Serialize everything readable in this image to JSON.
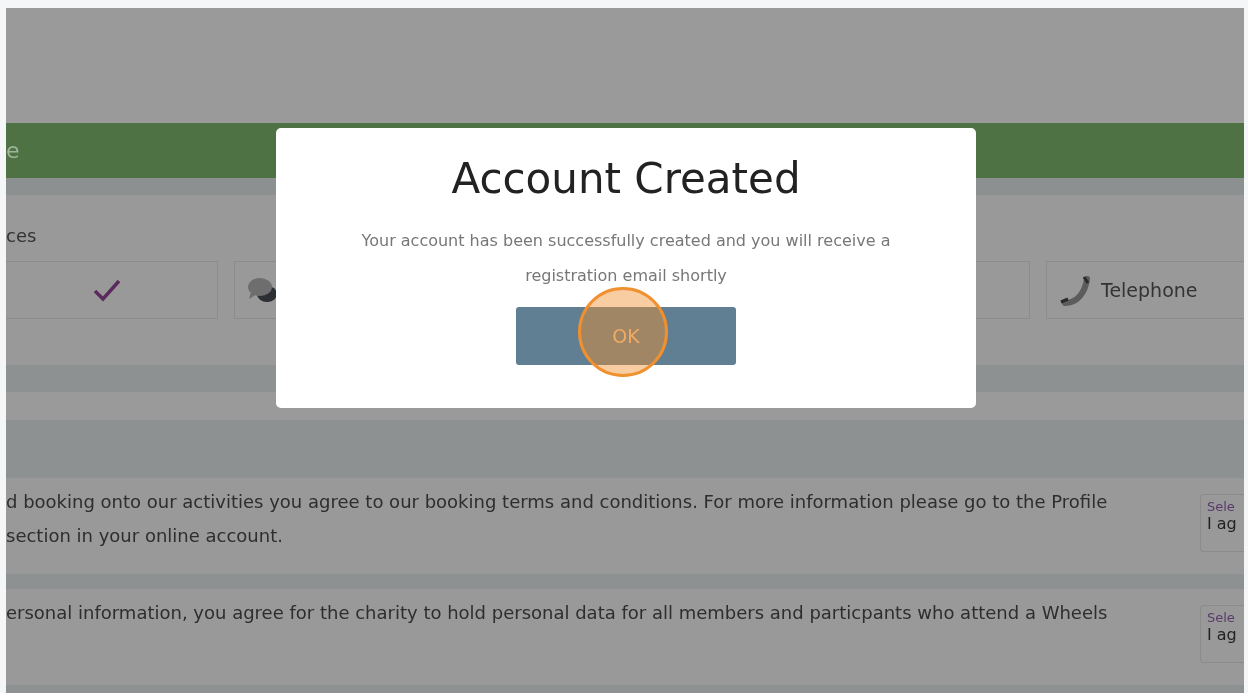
{
  "banner": {
    "title_fragment": "e"
  },
  "preferences": {
    "label_fragment": "ces",
    "options": [
      {
        "kind": "check"
      },
      {
        "kind": "chat"
      },
      {
        "kind": "blank"
      },
      {
        "kind": "phone",
        "label": "Telephone"
      }
    ]
  },
  "agreements": [
    {
      "lines": [
        "d booking onto our activities you agree to our booking terms and conditions. For more information please go to the Profile",
        "section in your online account."
      ],
      "select": {
        "placeholder": "Sele",
        "value": "I ag"
      }
    },
    {
      "lines": [
        "ersonal information, you agree for the charity to hold personal data for all members and particpants who attend a Wheels"
      ],
      "select": {
        "placeholder": "Sele",
        "value": "I ag"
      }
    }
  ],
  "modal": {
    "title": "Account Created",
    "message": [
      "Your account has been successfully created and you will receive a",
      "registration email shortly"
    ],
    "button": {
      "label": "OK",
      "click_marker": true
    }
  }
}
